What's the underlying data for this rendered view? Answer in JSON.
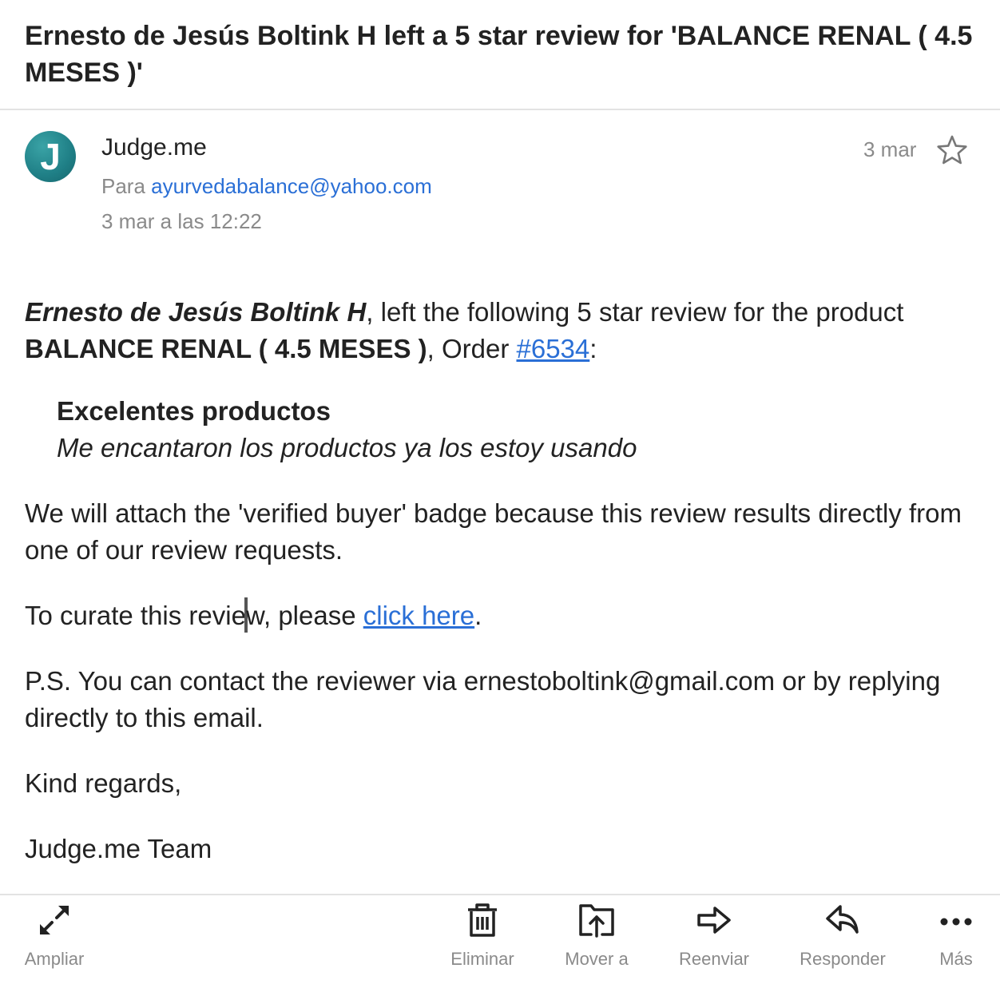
{
  "email": {
    "subject": "Ernesto de Jesús Boltink H left a 5 star review for 'BALANCE RENAL ( 4.5 MESES )'",
    "sender": {
      "avatar_letter": "J",
      "name": "Judge.me",
      "to_label": "Para",
      "to_address": "ayurvedabalance@yahoo.com",
      "datetime": "3 mar a las 12:22",
      "date_short": "3 mar"
    },
    "body": {
      "reviewer": "Ernesto de Jesús Boltink H",
      "intro_1": ", left the following 5 star review for the product ",
      "product": "BALANCE RENAL ( 4.5 MESES )",
      "intro_2": ", Order ",
      "order_link": "#6534",
      "intro_3": ":",
      "review_title": "Excelentes productos",
      "review_text": "Me encantaron los productos ya los estoy usando",
      "verified_note": "We will attach the 'verified buyer' badge because this review results directly from one of our review requests.",
      "curate_1": "To curate this revie",
      "curate_2": "w, please ",
      "curate_link": "click here",
      "curate_3": ".",
      "ps": "P.S. You can contact the reviewer via ernestoboltink@gmail.com or by replying directly to this email.",
      "regards": "Kind regards,",
      "signature": "Judge.me Team"
    }
  },
  "toolbar": {
    "expand": "Ampliar",
    "delete": "Eliminar",
    "move": "Mover a",
    "forward": "Reenviar",
    "reply": "Responder",
    "more": "Más"
  },
  "colors": {
    "link": "#2a6fd6",
    "avatar": "#1f7f86",
    "muted_text": "#8a8a8a"
  }
}
